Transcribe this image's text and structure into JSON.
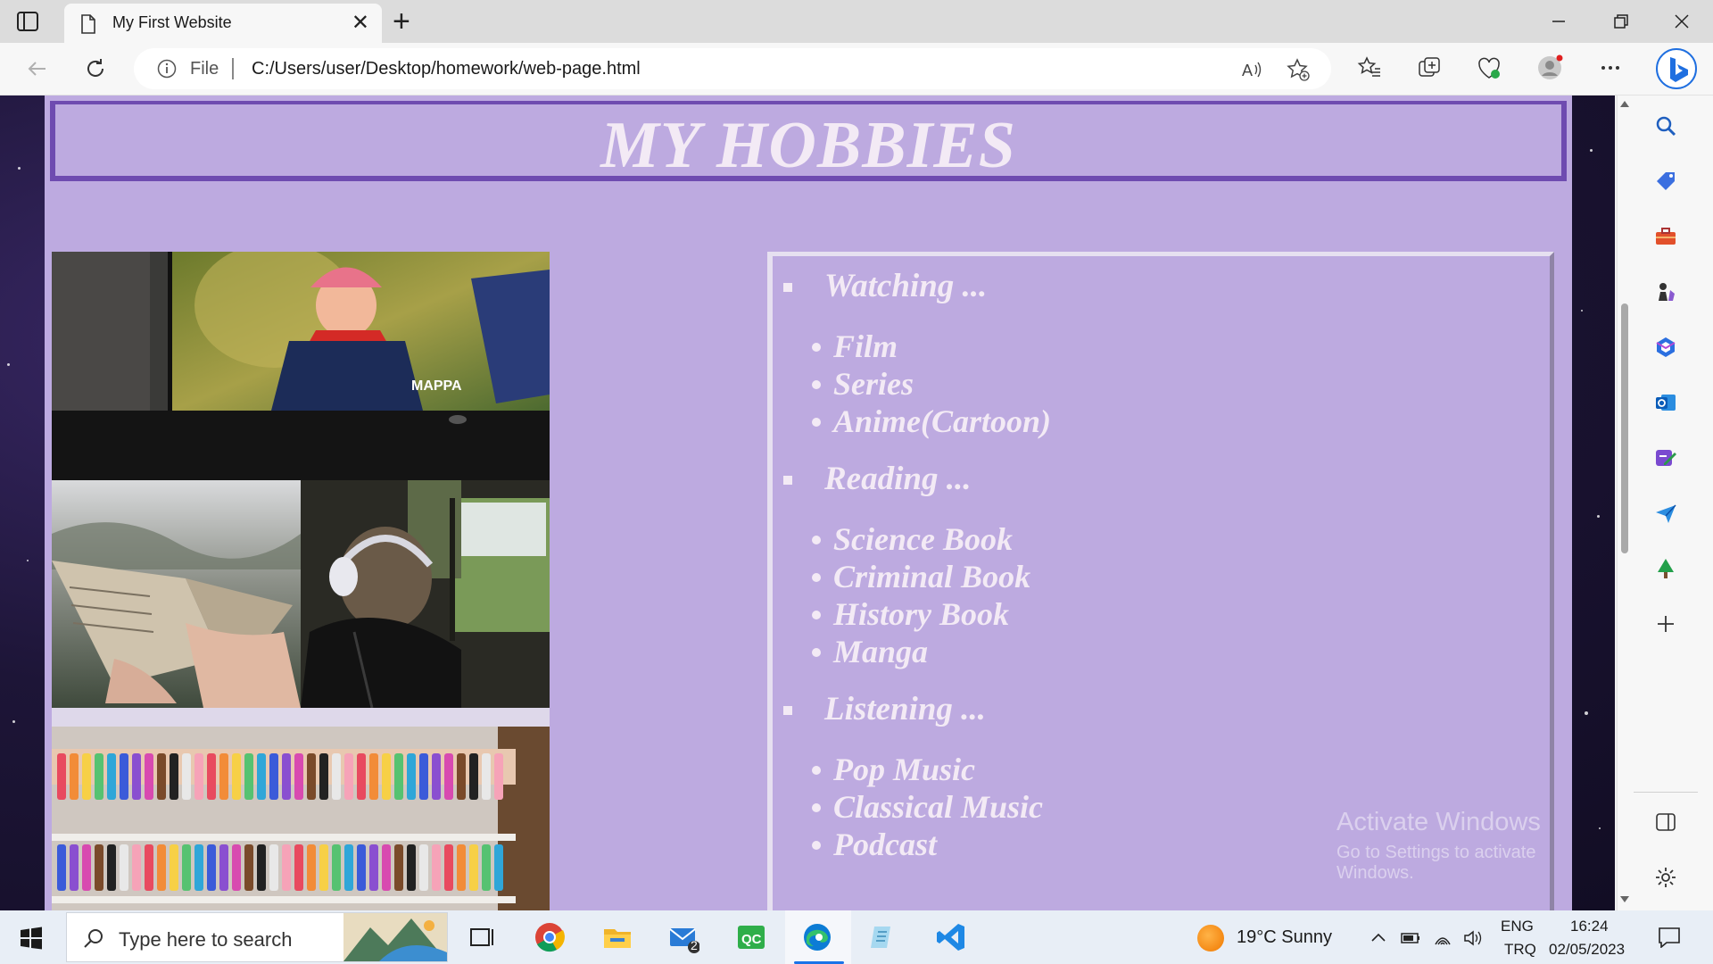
{
  "browser": {
    "tab_title": "My First Website",
    "omnibox_scheme_label": "File",
    "url": "C:/Users/user/Desktop/homework/web-page.html"
  },
  "page": {
    "title": "MY HOBBIES",
    "hobbies": [
      {
        "title": "Watching ...",
        "items": [
          "Film",
          "Series",
          "Anime(Cartoon)"
        ]
      },
      {
        "title": "Reading ...",
        "items": [
          "Science Book",
          "Criminal Book",
          "History Book",
          "Manga"
        ]
      },
      {
        "title": "Listening ...",
        "items": [
          "Pop Music",
          "Classical Music",
          "Podcast"
        ]
      }
    ],
    "photos": [
      "anime-on-tv-photo",
      "reading-book-photo",
      "listening-headphones-photo",
      "markers-collection-photo"
    ]
  },
  "watermark": {
    "title": "Activate Windows",
    "subtitle": "Go to Settings to activate Windows."
  },
  "taskbar": {
    "search_placeholder": "Type here to search",
    "mail_badge": "2",
    "weather": "19°C  Sunny",
    "lang_top": "ENG",
    "lang_bottom": "TRQ",
    "time": "16:24",
    "date": "02/05/2023"
  },
  "colors": {
    "page_bg": "#bdaae0",
    "header_border": "#6e4bb0",
    "text": "#f3eaf5",
    "accent": "#1a73e8"
  }
}
